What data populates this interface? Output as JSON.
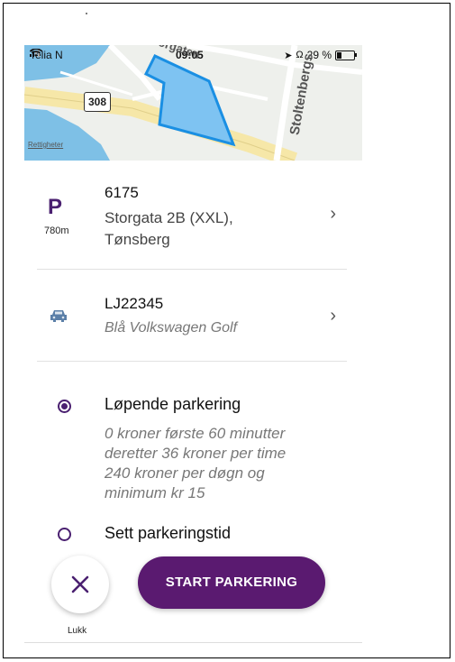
{
  "status_bar": {
    "carrier": "Telia N",
    "time": "09:05",
    "battery": "29 %",
    "battery_level": 0.29,
    "icons": [
      "signal-icon",
      "wifi-icon",
      "location-icon",
      "headphones-icon",
      "battery-icon"
    ]
  },
  "map": {
    "road_number": "308",
    "street_top": "orgaten",
    "street_right": "Stoltenbergs",
    "attribution": "Rettigheter",
    "zone_color": "#7ec3f2",
    "zone_border": "#1a8fe3"
  },
  "zone": {
    "icon_letter": "P",
    "distance": "780m",
    "number": "6175",
    "address": "Storgata 2B (XXL), Tønsberg"
  },
  "vehicle": {
    "plate": "LJ22345",
    "description": "Blå Volkswagen Golf",
    "icon": "car-icon"
  },
  "options": {
    "continuous": {
      "label": "Løpende parkering",
      "selected": true,
      "lines": [
        "0 kroner første 60 minutter",
        "deretter 36 kroner per time",
        "240 kroner per døgn og",
        "minimum kr 15"
      ]
    },
    "set_time": {
      "label": "Sett parkeringstid",
      "selected": false
    }
  },
  "actions": {
    "close_label": "Lukk",
    "start_label": "START PARKERING"
  },
  "colors": {
    "accent": "#4a2070",
    "button": "#5a1a70"
  }
}
